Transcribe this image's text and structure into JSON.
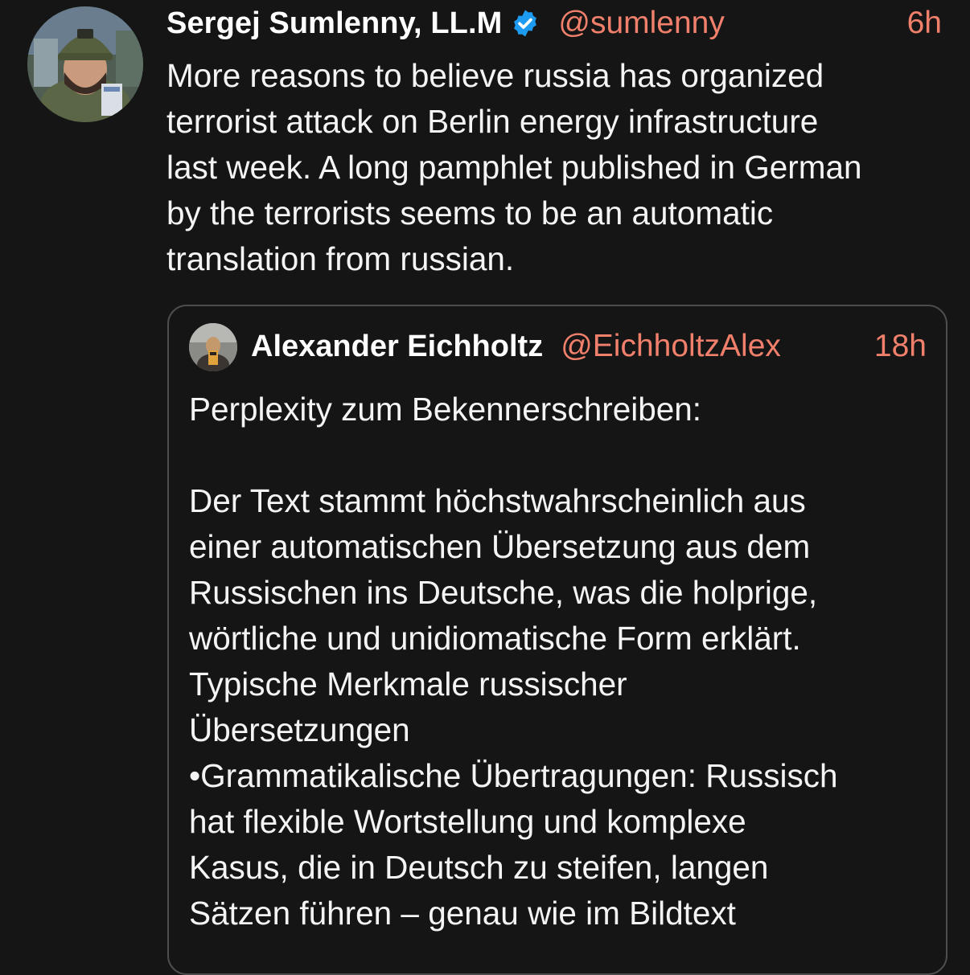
{
  "post": {
    "author": {
      "display_name": "Sergej Sumlenny, LL.M",
      "verified": true,
      "verified_icon": "verified-badge-icon",
      "handle": "@sumlenny",
      "time": "6h"
    },
    "text": "More reasons to believe russia has organized\nterrorist attack on Berlin energy infrastructure\nlast week. A long pamphlet published in German\nby the terrorists seems to be an automatic\ntranslation from russian."
  },
  "quoted_post": {
    "author": {
      "display_name": "Alexander Eichholtz",
      "handle": "@EichholtzAlex",
      "time": "18h"
    },
    "text": "Perplexity zum Bekennerschreiben:\n\nDer Text stammt höchstwahrscheinlich aus\neiner automatischen Übersetzung aus dem\nRussischen ins Deutsche, was die holprige,\nwörtliche und unidiomatische Form erklärt.\nTypische Merkmale russischer\nÜbersetzungen\n•Grammatikalische Übertragungen: Russisch\nhat flexible Wortstellung und komplexe\nKasus, die in Deutsch zu steifen, langen\nSätzen führen – genau wie im Bildtext"
  },
  "colors": {
    "background": "#151515",
    "text": "#f4f4f4",
    "accent": "#f0806b",
    "verified": "#1d9bf0",
    "quote_border": "#4d4d4d"
  }
}
